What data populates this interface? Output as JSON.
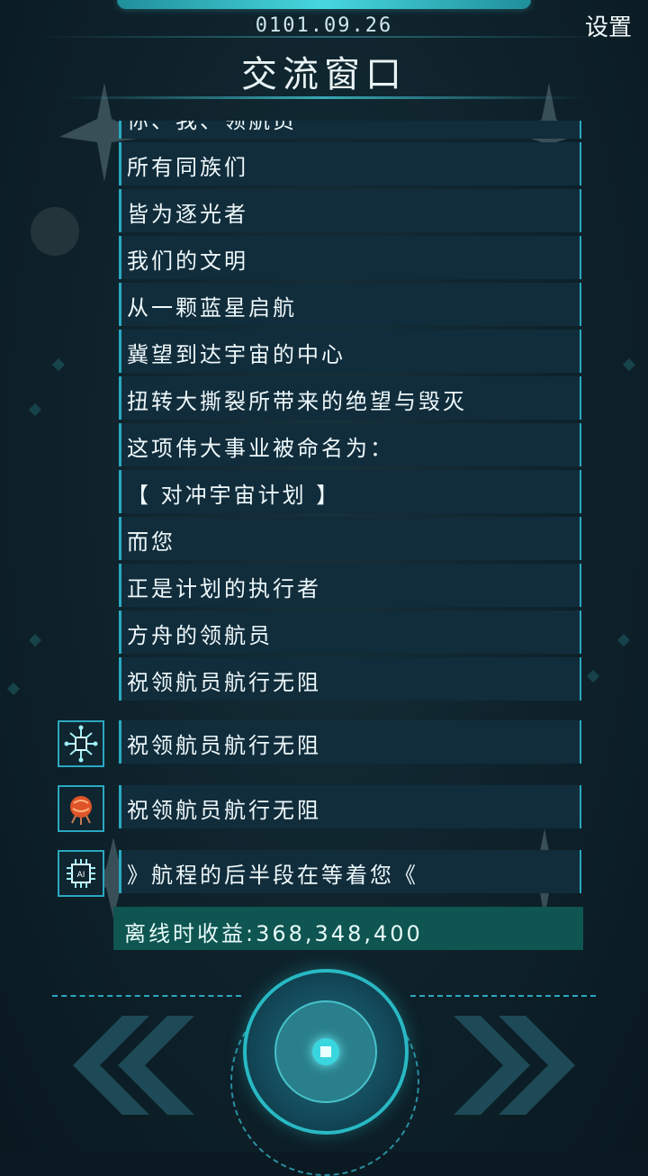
{
  "header": {
    "date": "0101.09.26",
    "settings_label": "设置",
    "title": "交流窗口"
  },
  "messages": [
    "你、我、领航员",
    "所有同族们",
    "皆为逐光者",
    "我们的文明",
    "从一颗蓝星启航",
    "冀望到达宇宙的中心",
    "扭转大撕裂所带来的绝望与毁灭",
    "这项伟大事业被命名为：",
    "【 对冲宇宙计划 】",
    "而您",
    "正是计划的执行者",
    "方舟的领航员",
    "祝领航员航行无阻"
  ],
  "replies": [
    {
      "text": "祝领航员航行无阻",
      "icon": "robot-circuit-icon"
    },
    {
      "text": "祝领航员航行无阻",
      "icon": "orange-brain-icon"
    },
    {
      "text": "》航程的后半段在等着您《",
      "icon": "ai-chip-icon"
    }
  ],
  "ai_chip_label": "AI",
  "income": {
    "label": "离线时收益:",
    "value": "368,348,400"
  },
  "colors": {
    "accent": "#2aa8c0",
    "message_bg": "#112d3c",
    "income_bg": "#0f5552",
    "background": "#0b1a22"
  },
  "controls": {
    "left": "double-chevron-left-icon",
    "center": "engine-core-button",
    "right": "double-chevron-right-icon"
  }
}
